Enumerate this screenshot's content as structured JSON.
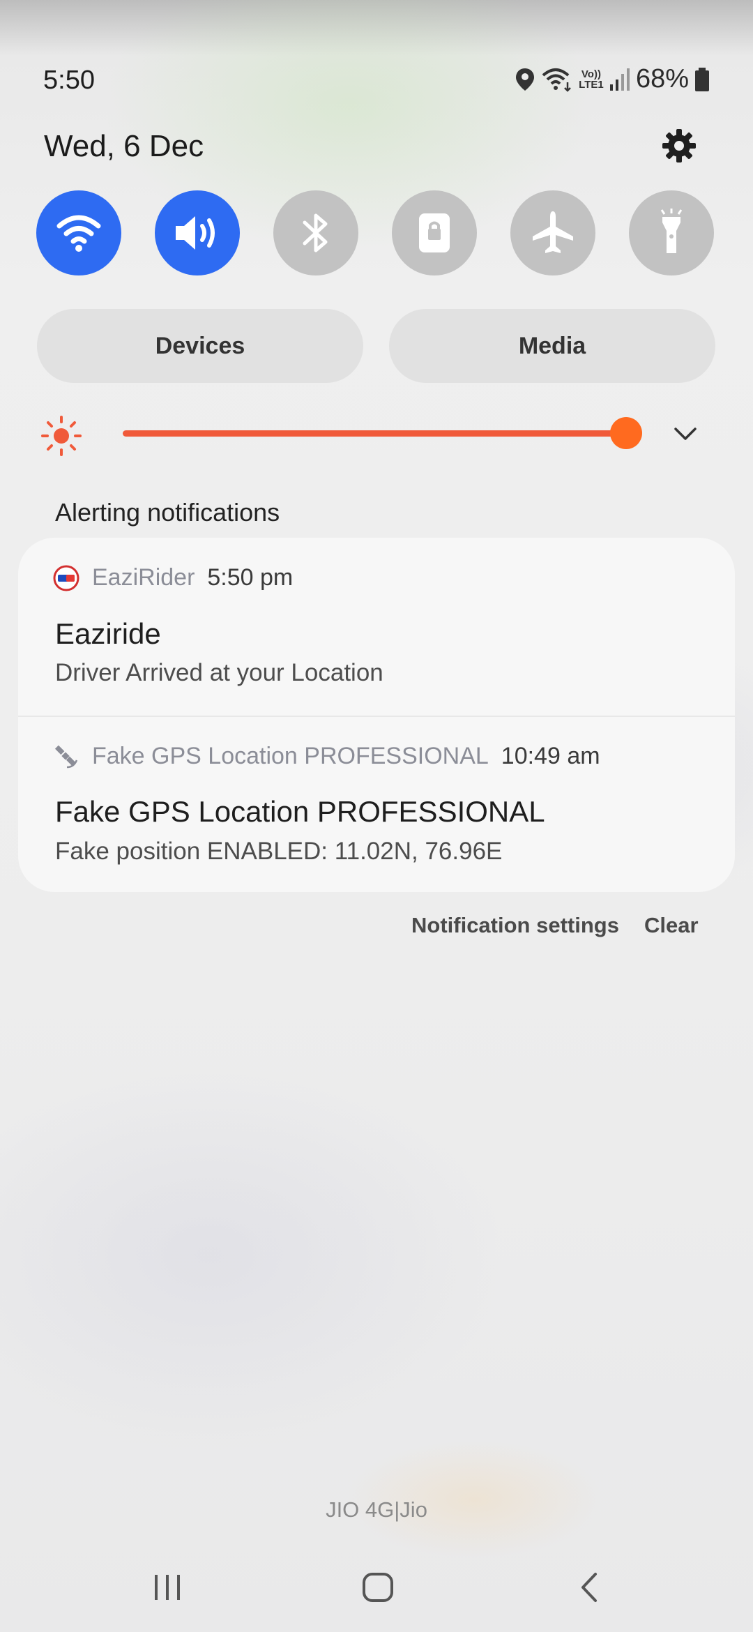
{
  "status_bar": {
    "time": "5:50",
    "battery": "68%",
    "network_label": "Vo)) LTE1",
    "icons": [
      "location-icon",
      "wifi-icon",
      "volte-icon",
      "signal-icon",
      "battery-icon"
    ]
  },
  "header": {
    "date": "Wed, 6 Dec"
  },
  "quick_settings": {
    "toggles": [
      {
        "name": "Wi-Fi",
        "icon": "wifi-icon",
        "state": "on"
      },
      {
        "name": "Sound",
        "icon": "speaker-icon",
        "state": "on"
      },
      {
        "name": "Bluetooth",
        "icon": "bluetooth-icon",
        "state": "off"
      },
      {
        "name": "Portrait lock",
        "icon": "rotation-lock-icon",
        "state": "off"
      },
      {
        "name": "Airplane mode",
        "icon": "airplane-icon",
        "state": "off"
      },
      {
        "name": "Torch",
        "icon": "flashlight-icon",
        "state": "off"
      }
    ],
    "devices_label": "Devices",
    "media_label": "Media"
  },
  "brightness": {
    "level": 1.0,
    "color": "#f05a3a"
  },
  "notifications": {
    "section_label": "Alerting notifications",
    "items": [
      {
        "app": "EaziRider",
        "time": "5:50 pm",
        "title": "Eaziride",
        "body": "Driver Arrived at your Location",
        "icon": "eazirider-app-icon"
      },
      {
        "app": "Fake GPS Location PROFESSIONAL",
        "time": "10:49 am",
        "title": "Fake GPS Location PROFESSIONAL",
        "body": "Fake position ENABLED: 11.02N, 76.96E",
        "icon": "satellite-icon"
      }
    ],
    "settings_label": "Notification settings",
    "clear_label": "Clear"
  },
  "carrier": "JIO 4G|Jio",
  "colors": {
    "accent": "#2e6bf2",
    "brightness": "#f05a3a",
    "thumb": "#ff6a1f"
  }
}
